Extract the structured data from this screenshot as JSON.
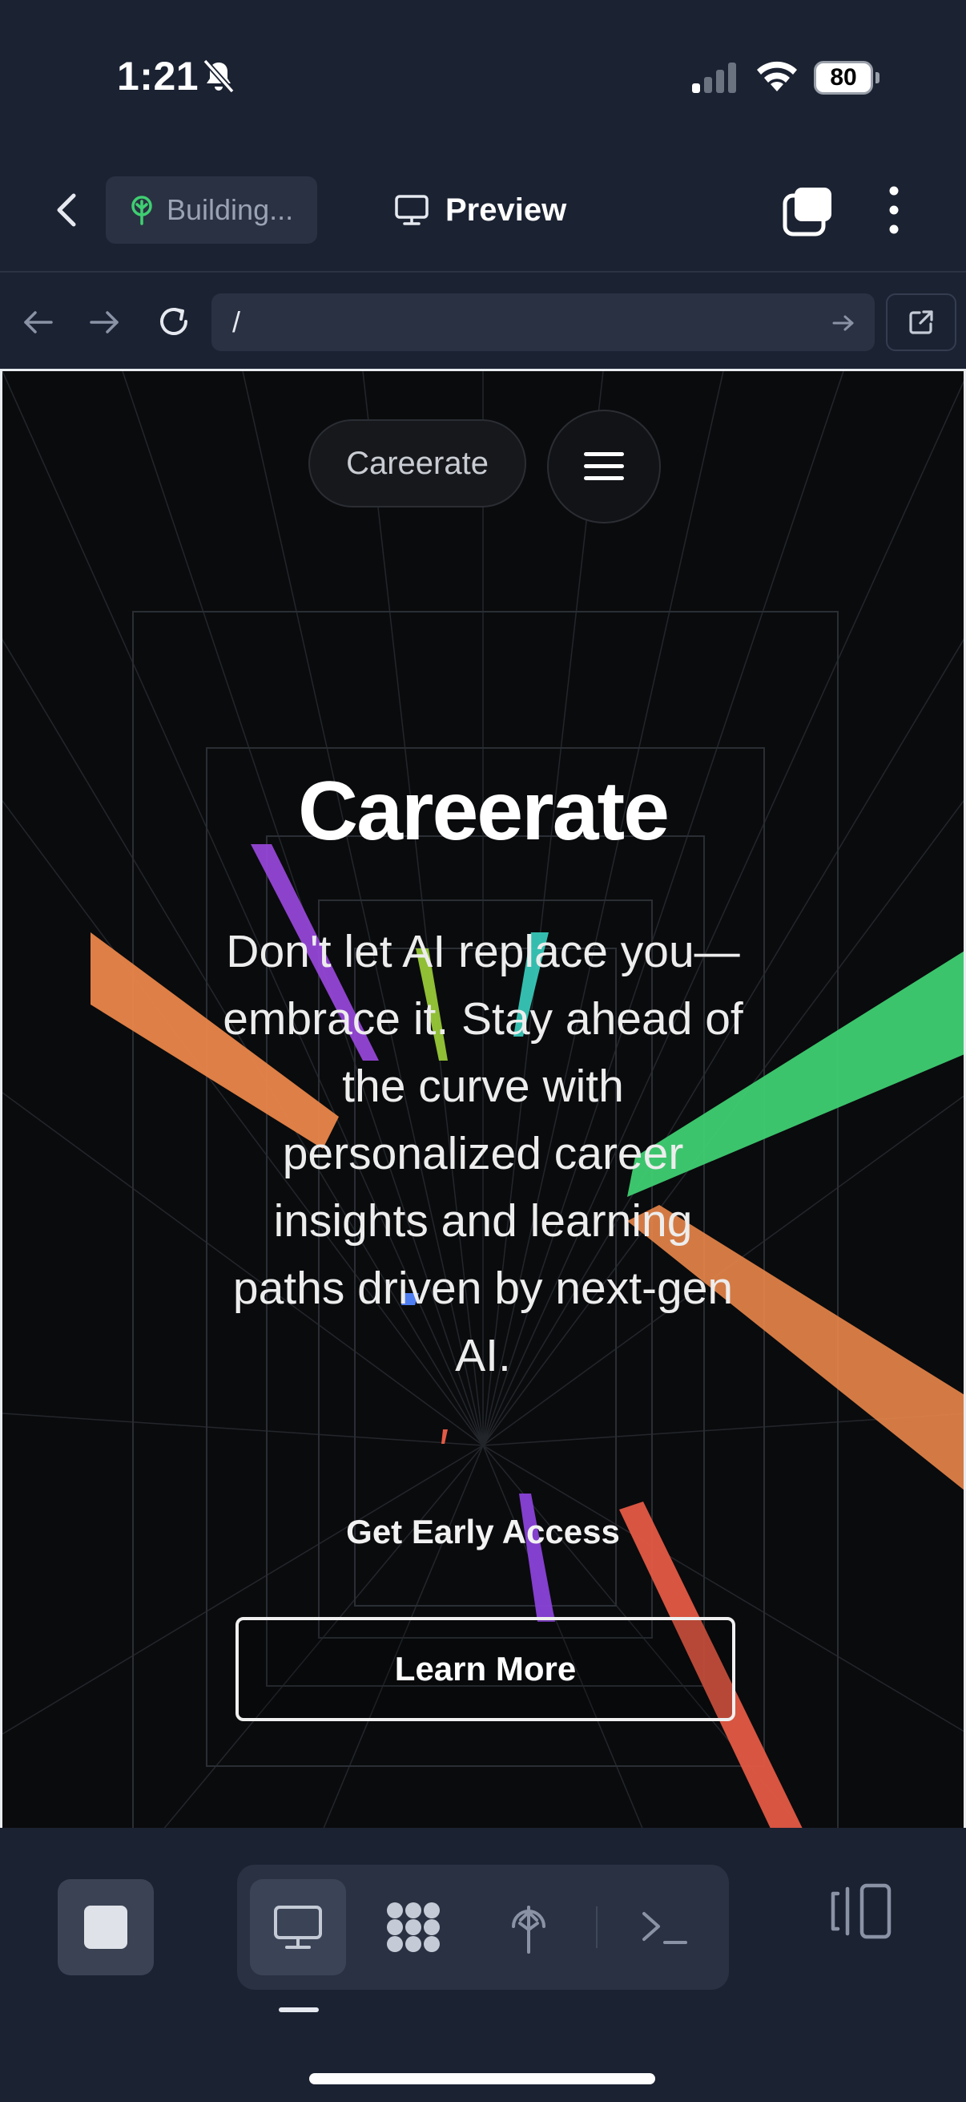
{
  "status": {
    "time": "1:21",
    "battery": "80"
  },
  "header": {
    "building_label": "Building...",
    "preview_label": "Preview"
  },
  "address": {
    "url": "/"
  },
  "site": {
    "brand": "Careerate",
    "title": "Careerate",
    "subtitle": "Don't let AI replace you—embrace it. Stay ahead of the curve with personalized career insights and learning paths driven by next-gen AI.",
    "cta_primary": "Get Early Access",
    "cta_secondary": "Learn More"
  },
  "toolbar": {
    "tools": [
      "desktop-icon",
      "apps-icon",
      "deploy-icon",
      "terminal-icon"
    ],
    "active_tool": "desktop-icon"
  },
  "colors": {
    "app_bg": "#1b2232",
    "panel": "#2a3142",
    "site_bg": "#0a0b0d",
    "accent_green": "#3fcf72",
    "accent_orange": "#e9864a"
  }
}
